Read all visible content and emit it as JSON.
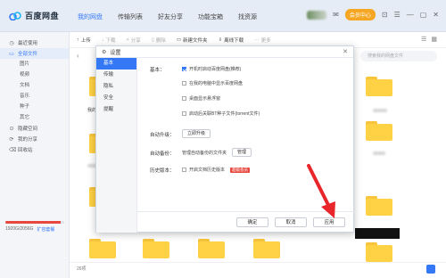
{
  "app": {
    "title": "百度网盘",
    "tabs": [
      "我的网盘",
      "传输列表",
      "好友分享",
      "功能宝箱",
      "找资源"
    ],
    "vip_label": "会员中心"
  },
  "toolbar": {
    "upload": "上传",
    "download": "下载",
    "share": "分享",
    "delete": "删除",
    "new_folder": "新建文件夹",
    "offline": "离线下载",
    "more": "更多"
  },
  "search": {
    "placeholder": "搜索我的网盘文件"
  },
  "sidebar": {
    "items": [
      {
        "label": "最近使用",
        "icon": "clock-icon"
      },
      {
        "label": "全部文件",
        "icon": "folder-icon"
      }
    ],
    "sub_items": [
      "图片",
      "视频",
      "文档",
      "音乐",
      "种子",
      "其它"
    ],
    "bottom_items": [
      {
        "label": "隐藏空间",
        "icon": "lock-icon"
      },
      {
        "label": "我的分享",
        "icon": "share-icon"
      },
      {
        "label": "回收站",
        "icon": "trash-icon"
      }
    ]
  },
  "storage": {
    "used_text": "1920G/2056G",
    "upgrade": "扩容套餐",
    "fraction": 0.934
  },
  "content": {
    "file_label": "我的",
    "status": "26项"
  },
  "dialog": {
    "title": "设置",
    "nav": [
      "基本",
      "传输",
      "隐私",
      "安全",
      "提醒"
    ],
    "basic_label": "基本：",
    "options": [
      {
        "label": "开机时启动百度网盘(推荐)",
        "checked": true
      },
      {
        "label": "在我的电脑中显示百度网盘",
        "checked": false
      },
      {
        "label": "桌面显示悬浮窗",
        "checked": false
      },
      {
        "label": "启动后关联BT种子文件(torrent文件)",
        "checked": false
      }
    ],
    "auto_upgrade_label": "自动升级：",
    "upgrade_button": "立即升级",
    "auto_backup_label": "自动备份：",
    "backup_hint": "管理自动备份的文件夹",
    "manage_button": "管理",
    "history_label": "历史版本：",
    "history_option": "开启文档历史版本",
    "history_tag": "超级会员",
    "confirm": "确定",
    "cancel": "取消",
    "apply": "应用"
  }
}
